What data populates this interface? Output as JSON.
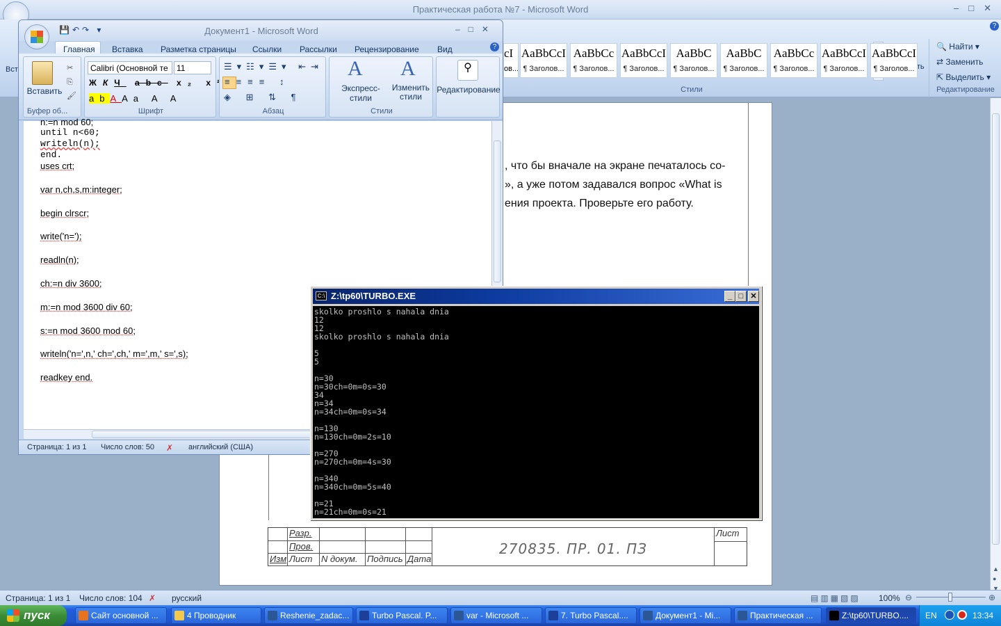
{
  "main_window": {
    "title": "Практическая работа №7 - Microsoft Word",
    "ribbon": {
      "styles": [
        {
          "sample": "AaBbCcI",
          "name": "¶ Заголов..."
        },
        {
          "sample": "AaBbCc",
          "name": "¶ Заголов..."
        },
        {
          "sample": "AaBbCcI",
          "name": "¶ Заголов..."
        },
        {
          "sample": "AaBbC",
          "name": "¶ Заголов..."
        },
        {
          "sample": "AaBbC",
          "name": "¶ Заголов..."
        },
        {
          "sample": "AaBbCc",
          "name": "¶ Заголов..."
        },
        {
          "sample": "AaBbCcI",
          "name": "¶ Заголов..."
        },
        {
          "sample": "AaBbCcI",
          "name": "¶ Заголов..."
        }
      ],
      "partial_style": {
        "sample": "cI",
        "name": "ов..."
      },
      "change_styles_label": "Изменить стили",
      "styles_group_label": "Стили",
      "find_label": "Найти",
      "replace_label": "Заменить",
      "select_label": "Выделить",
      "editing_group_label": "Редактирование",
      "left_partial": "Вст"
    },
    "document": {
      "lines": [
        ", что бы вначале на экране печаталось со-",
        "», а уже потом задавался вопрос «What is",
        "ения проекта. Проверьте его работу."
      ],
      "stamp": {
        "code": "270835. ПР. 01. ПЗ",
        "sheet_label": "Лист",
        "row1": "Разр.",
        "row2": "Пров.",
        "headers": [
          "Изм",
          "Лист",
          "N докум.",
          "Подпись",
          "Дата"
        ]
      }
    },
    "status": {
      "page": "Страница: 1 из 1",
      "words": "Число слов: 104",
      "language": "русский",
      "zoom": "100%"
    }
  },
  "doc1_window": {
    "title": "Документ1 - Microsoft Word",
    "tabs": [
      "Главная",
      "Вставка",
      "Разметка страницы",
      "Ссылки",
      "Рассылки",
      "Рецензирование",
      "Вид"
    ],
    "font_name": "Calibri (Основной те",
    "font_size": "11",
    "paste_label": "Вставить",
    "clipboard_group": "Буфер об...",
    "font_group": "Шрифт",
    "paragraph_group": "Абзац",
    "styles_group": "Стили",
    "express_styles": "Экспресс-стили",
    "change_styles": "Изменить стили",
    "editing_label": "Редактирование",
    "code_top": [
      "until n<60;",
      "writeln(n);",
      "end."
    ],
    "code": [
      "uses crt;",
      "var n,ch,s,m:integer;",
      "begin clrscr;",
      "write('n=');",
      "readln(n);",
      "ch:=n div 3600;",
      "m:=n mod 3600  div 60;",
      "s:=n mod 3600  mod 60;",
      "writeln('n=',n,' ch=',ch,' m=',m,' s=',s);",
      "readkey end."
    ],
    "status": {
      "page": "Страница: 1 из 1",
      "words": "Число слов: 50",
      "language": "английский (США)"
    }
  },
  "console": {
    "title": "Z:\\tp60\\TURBO.EXE",
    "lines": [
      "skolko proshlo s nahala dnia",
      "12",
      "12",
      "skolko proshlo s nahala dnia",
      "",
      "5",
      "5",
      "",
      "n=30",
      "n=30ch=0m=0s=30",
      "34",
      "n=34",
      "n=34ch=0m=0s=34",
      "",
      "n=130",
      "n=130ch=0m=2s=10",
      "",
      "n=270",
      "n=270ch=0m=4s=30",
      "",
      "n=340",
      "n=340ch=0m=5s=40",
      "",
      "n=21",
      "n=21ch=0m=0s=21"
    ]
  },
  "taskbar": {
    "start": "пуск",
    "items": [
      "Сайт основной ...",
      "4 Проводник",
      "Reshenie_zadac...",
      "Turbo Pascal. P...",
      "var - Microsoft ...",
      "7. Turbo Pascal....",
      "Документ1 - Mi...",
      "Практическая ...",
      "Z:\\tp60\\TURBO...."
    ],
    "lang": "EN",
    "clock": "13:34"
  },
  "colors": {
    "accent": "#245edb",
    "ribbon": "#c8daf1",
    "console_title": "#0a246a"
  }
}
